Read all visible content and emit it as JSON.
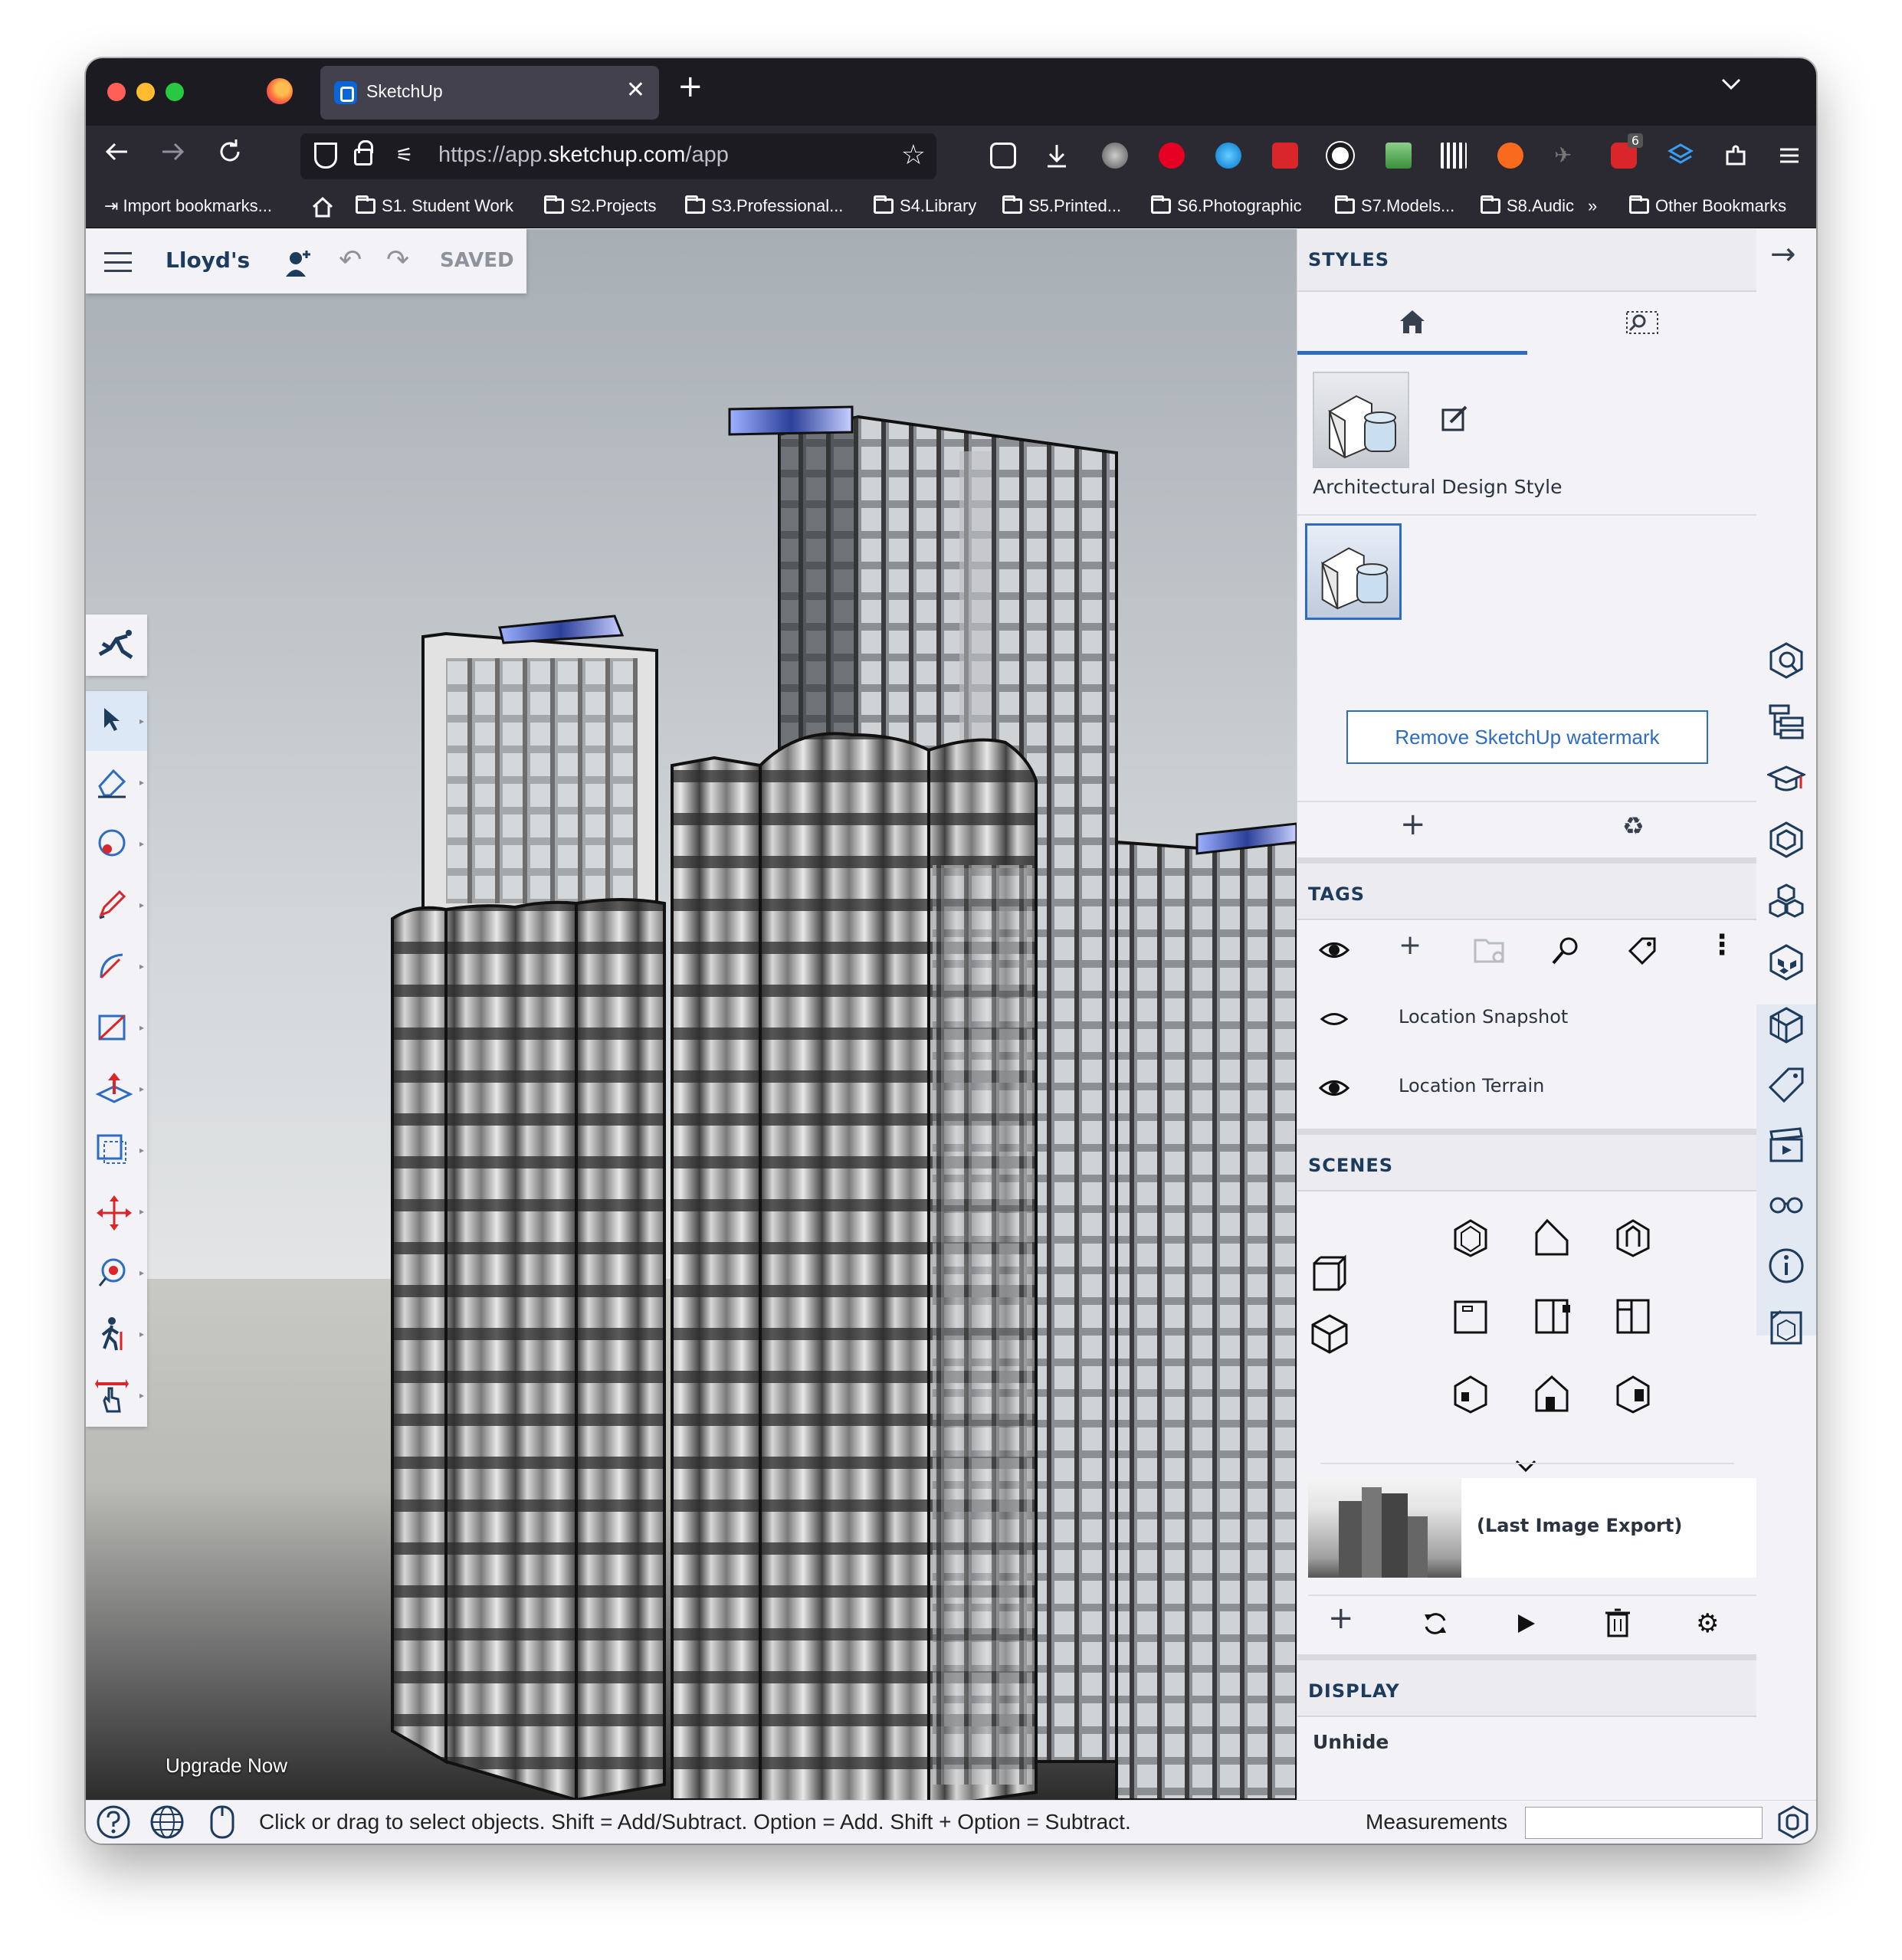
{
  "browser": {
    "tab_title": "SketchUp",
    "url_scheme": "https://app.",
    "url_domain": "sketchup.com",
    "url_path": "/app",
    "extension_badge": "6",
    "bookmarks": [
      "Import bookmarks...",
      "S1. Student Work",
      "S2.Projects",
      "S3.Professional...",
      "S4.Library",
      "S5.Printed...",
      "S6.Photographic",
      "S7.Models...",
      "S8.Audic",
      "Other Bookmarks"
    ]
  },
  "app": {
    "project_name": "Lloyd's",
    "save_status": "SAVED",
    "upgrade_label": "Upgrade Now"
  },
  "styles": {
    "header": "STYLES",
    "style_name": "Architectural Design Style",
    "watermark_button": "Remove SketchUp watermark"
  },
  "tags": {
    "header": "TAGS",
    "items": [
      {
        "name": "Location Snapshot",
        "visible": false
      },
      {
        "name": "Location Terrain",
        "visible": true
      }
    ]
  },
  "scenes": {
    "header": "SCENES",
    "items": [
      {
        "label": "(Last Image Export)"
      }
    ]
  },
  "display": {
    "header": "DISPLAY",
    "unhide_label": "Unhide"
  },
  "status_bar": {
    "hint": "Click or drag to select objects. Shift = Add/Subtract. Option = Add. Shift + Option = Subtract.",
    "measurements_label": "Measurements",
    "measurements_value": ""
  },
  "colors": {
    "accent": "#2d6cc0",
    "navy_text": "#1d3b5c",
    "browser_dark": "#1c1b22"
  }
}
